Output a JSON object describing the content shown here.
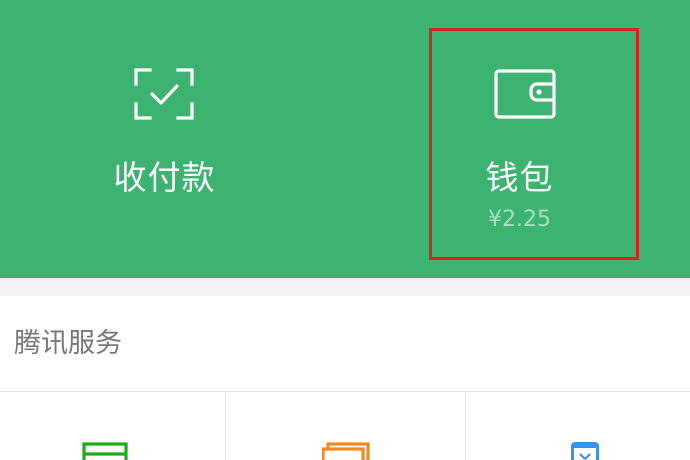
{
  "header": {
    "pay": {
      "label": "收付款",
      "icon": "scan-check-icon"
    },
    "wallet": {
      "label": "钱包",
      "balance": "¥2.25",
      "icon": "wallet-icon"
    }
  },
  "services": {
    "title": "腾讯服务",
    "items": [
      {
        "icon": "credit-card-icon",
        "color": "#1aad19"
      },
      {
        "icon": "wealth-icon",
        "color": "#f08a24"
      },
      {
        "icon": "mobile-topup-icon",
        "color": "#3d8ef0"
      }
    ]
  },
  "colors": {
    "header_green": "#3cb371",
    "highlight_red": "#d9211d",
    "balance_text": "#a9dfbf",
    "section_title": "#777777"
  }
}
